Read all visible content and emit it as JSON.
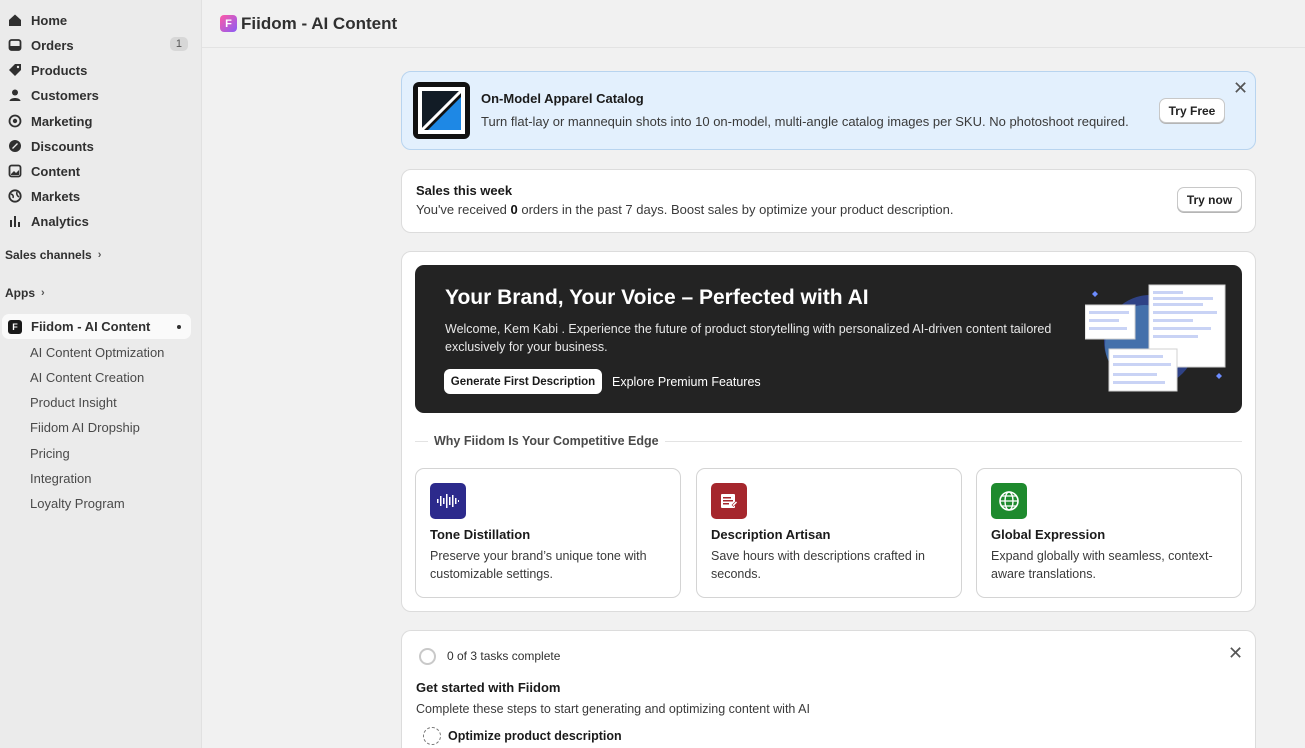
{
  "sidebar": {
    "nav": [
      {
        "label": "Home",
        "icon": "home-icon"
      },
      {
        "label": "Orders",
        "icon": "orders-icon",
        "badge": "1"
      },
      {
        "label": "Products",
        "icon": "tag-icon"
      },
      {
        "label": "Customers",
        "icon": "person-icon"
      },
      {
        "label": "Marketing",
        "icon": "target-icon"
      },
      {
        "label": "Discounts",
        "icon": "discount-icon"
      },
      {
        "label": "Content",
        "icon": "content-icon"
      },
      {
        "label": "Markets",
        "icon": "globe-icon"
      },
      {
        "label": "Analytics",
        "icon": "bar-chart-icon"
      }
    ],
    "sales_channels": "Sales channels",
    "apps": "Apps",
    "active_app": "Fiidom - AI Content",
    "sub_items": [
      "AI Content Optmization",
      "AI Content Creation",
      "Product Insight",
      "Fiidom AI Dropship",
      "Pricing",
      "Integration",
      "Loyalty Program"
    ]
  },
  "header": {
    "title": "Fiidom - AI Content"
  },
  "promo": {
    "title": "On-Model Apparel Catalog",
    "text": "Turn flat-lay or mannequin shots into 10 on-model, multi-angle catalog images per SKU. No photoshoot required.",
    "button": "Try Free"
  },
  "sales": {
    "title": "Sales this week",
    "text_before": "You've received ",
    "count": "0",
    "text_after": " orders in the past 7 days. Boost sales by optimize your product description.",
    "button": "Try now"
  },
  "hero": {
    "title": "Your Brand, Your Voice – Perfected with AI",
    "subtitle": "Welcome, Kem Kabi . Experience the future of product storytelling with personalized AI-driven content tailored exclusively for your business.",
    "primary_button": "Generate First Description",
    "secondary_button": "Explore Premium Features"
  },
  "why": {
    "label": "Why Fiidom Is Your Competitive Edge"
  },
  "features": [
    {
      "title": "Tone Distillation",
      "text": "Preserve your brand’s unique tone with customizable settings.",
      "icon": "waveform-icon",
      "color": "#2c2a8c"
    },
    {
      "title": "Description Artisan",
      "text": "Save hours with descriptions crafted in seconds.",
      "icon": "document-edit-icon",
      "color": "#a5272d"
    },
    {
      "title": "Global Expression",
      "text": "Expand globally with seamless, context-aware translations.",
      "icon": "globe-icon",
      "color": "#1e8a2e"
    }
  ],
  "tasks": {
    "count": "0 of 3 tasks complete",
    "heading": "Get started with Fiidom",
    "description": "Complete these steps to start generating and optimizing content with AI",
    "first_task": "Optimize product description"
  }
}
